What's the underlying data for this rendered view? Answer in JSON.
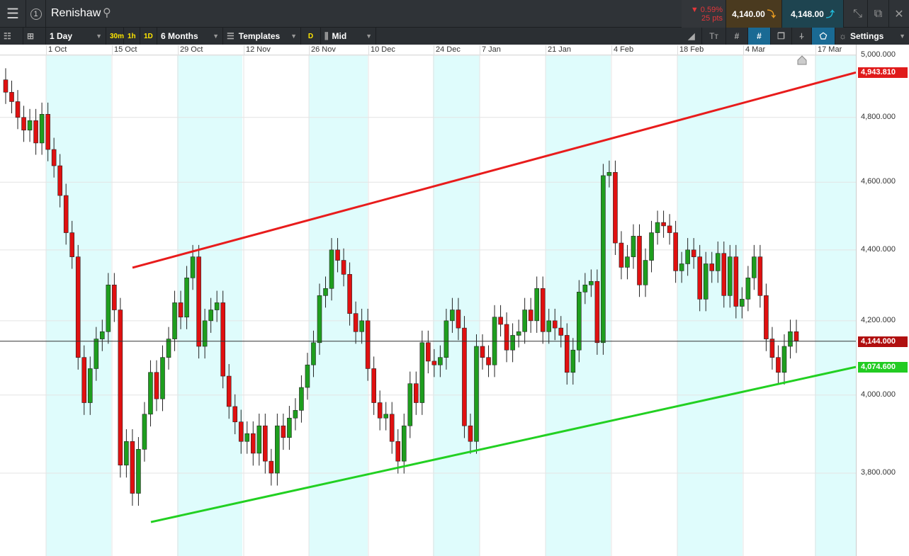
{
  "header": {
    "instrument": "Renishaw",
    "change_pct": "▼ 0.59%",
    "change_pts": "25 pts",
    "sell_price": "4,140.00",
    "buy_price": "4,148.00",
    "badge_number": "1"
  },
  "toolbar": {
    "interval": "1 Day",
    "quick_intervals": [
      "30m",
      "1h",
      "1D"
    ],
    "range": "6 Months",
    "templates": "Templates",
    "d_label": "D",
    "price_type": "Mid",
    "settings": "Settings"
  },
  "dates": [
    "1 Oct",
    "15 Oct",
    "29 Oct",
    "12 Nov",
    "26 Nov",
    "10 Dec",
    "24 Dec",
    "7 Jan",
    "21 Jan",
    "4 Feb",
    "18 Feb",
    "4 Mar",
    "17 Mar"
  ],
  "colors": {
    "up": "#1e9e1e",
    "down": "#e01010",
    "resistance": "#e81c1c",
    "support": "#22d022",
    "shade": "#dffcfc"
  },
  "chart_data": {
    "type": "candlestick",
    "scale": "log",
    "ylim": [
      3600,
      5000
    ],
    "y_ticks": [
      "5,000.000",
      "4,800.000",
      "4,600.000",
      "4,400.000",
      "4,200.000",
      "4,000.000",
      "3,800.000"
    ],
    "y_tick_values": [
      5000,
      4800,
      4600,
      4400,
      4200,
      4000,
      3800
    ],
    "closes": [
      4880,
      4850,
      4800,
      4760,
      4790,
      4720,
      4810,
      4700,
      4650,
      4560,
      4450,
      4380,
      4100,
      3980,
      4070,
      4150,
      4170,
      4300,
      4230,
      3820,
      3880,
      3750,
      3860,
      3950,
      4060,
      3990,
      4100,
      4150,
      4250,
      4210,
      4320,
      4380,
      4130,
      4200,
      4230,
      4250,
      4050,
      3970,
      3930,
      3880,
      3900,
      3850,
      3920,
      3830,
      3800,
      3920,
      3890,
      3940,
      3960,
      4020,
      4080,
      4140,
      4270,
      4290,
      4400,
      4370,
      4330,
      4220,
      4170,
      4200,
      4070,
      3980,
      3940,
      3950,
      3880,
      3830,
      3920,
      4030,
      3980,
      4140,
      4090,
      4080,
      4100,
      4200,
      4230,
      4180,
      3920,
      3880,
      4130,
      4100,
      4080,
      4210,
      4190,
      4120,
      4160,
      4170,
      4230,
      4200,
      4290,
      4170,
      4200,
      4180,
      4160,
      4060,
      4120,
      4280,
      4300,
      4310,
      4140,
      4620,
      4630,
      4420,
      4350,
      4380,
      4440,
      4300,
      4370,
      4450,
      4480,
      4470,
      4450,
      4340,
      4360,
      4400,
      4380,
      4260,
      4360,
      4340,
      4390,
      4270,
      4380,
      4240,
      4260,
      4320,
      4380,
      4270,
      4150,
      4100,
      4060,
      4130,
      4170,
      4145
    ],
    "current_price": "4,144.000",
    "current_value": 4144,
    "resistance": {
      "label": "4,943.810",
      "start": 4349,
      "end": 4943.81
    },
    "support": {
      "label": "4,074.600",
      "start": 3680,
      "end": 4074.6
    }
  }
}
